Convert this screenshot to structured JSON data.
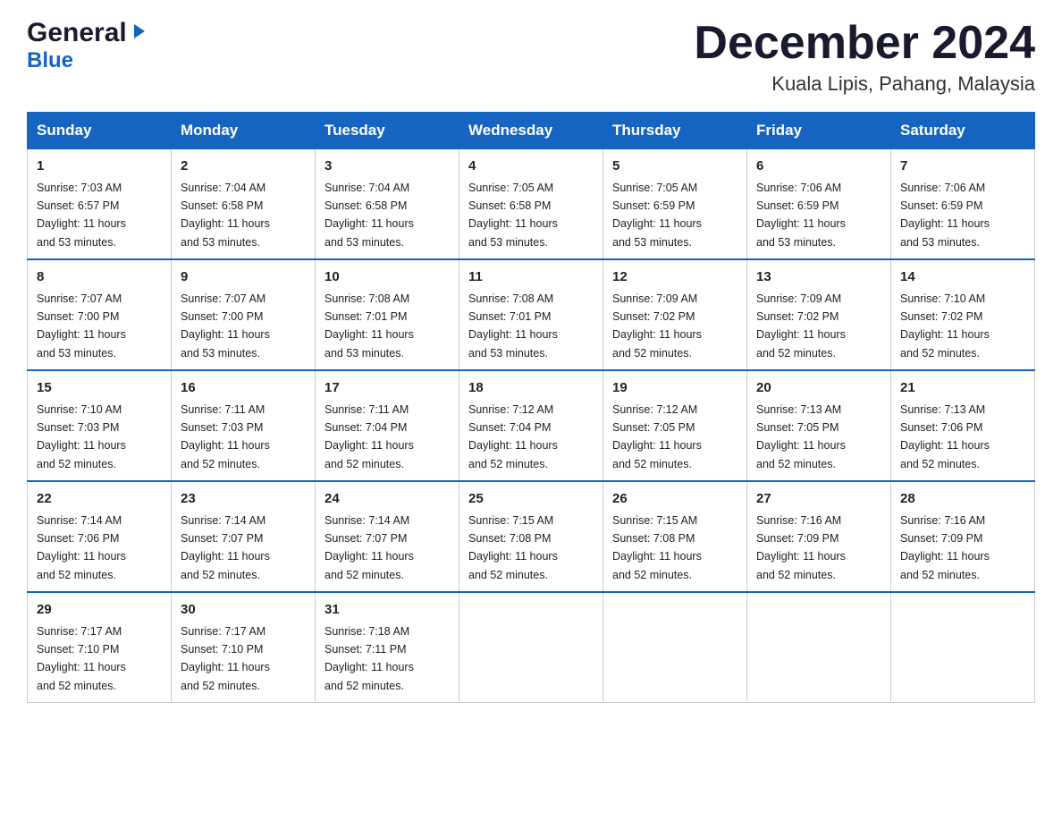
{
  "header": {
    "logo_general": "General",
    "logo_blue": "Blue",
    "month_title": "December 2024",
    "location": "Kuala Lipis, Pahang, Malaysia"
  },
  "days_of_week": [
    "Sunday",
    "Monday",
    "Tuesday",
    "Wednesday",
    "Thursday",
    "Friday",
    "Saturday"
  ],
  "weeks": [
    [
      {
        "day": "1",
        "sunrise": "7:03 AM",
        "sunset": "6:57 PM",
        "daylight": "11 hours and 53 minutes."
      },
      {
        "day": "2",
        "sunrise": "7:04 AM",
        "sunset": "6:58 PM",
        "daylight": "11 hours and 53 minutes."
      },
      {
        "day": "3",
        "sunrise": "7:04 AM",
        "sunset": "6:58 PM",
        "daylight": "11 hours and 53 minutes."
      },
      {
        "day": "4",
        "sunrise": "7:05 AM",
        "sunset": "6:58 PM",
        "daylight": "11 hours and 53 minutes."
      },
      {
        "day": "5",
        "sunrise": "7:05 AM",
        "sunset": "6:59 PM",
        "daylight": "11 hours and 53 minutes."
      },
      {
        "day": "6",
        "sunrise": "7:06 AM",
        "sunset": "6:59 PM",
        "daylight": "11 hours and 53 minutes."
      },
      {
        "day": "7",
        "sunrise": "7:06 AM",
        "sunset": "6:59 PM",
        "daylight": "11 hours and 53 minutes."
      }
    ],
    [
      {
        "day": "8",
        "sunrise": "7:07 AM",
        "sunset": "7:00 PM",
        "daylight": "11 hours and 53 minutes."
      },
      {
        "day": "9",
        "sunrise": "7:07 AM",
        "sunset": "7:00 PM",
        "daylight": "11 hours and 53 minutes."
      },
      {
        "day": "10",
        "sunrise": "7:08 AM",
        "sunset": "7:01 PM",
        "daylight": "11 hours and 53 minutes."
      },
      {
        "day": "11",
        "sunrise": "7:08 AM",
        "sunset": "7:01 PM",
        "daylight": "11 hours and 53 minutes."
      },
      {
        "day": "12",
        "sunrise": "7:09 AM",
        "sunset": "7:02 PM",
        "daylight": "11 hours and 52 minutes."
      },
      {
        "day": "13",
        "sunrise": "7:09 AM",
        "sunset": "7:02 PM",
        "daylight": "11 hours and 52 minutes."
      },
      {
        "day": "14",
        "sunrise": "7:10 AM",
        "sunset": "7:02 PM",
        "daylight": "11 hours and 52 minutes."
      }
    ],
    [
      {
        "day": "15",
        "sunrise": "7:10 AM",
        "sunset": "7:03 PM",
        "daylight": "11 hours and 52 minutes."
      },
      {
        "day": "16",
        "sunrise": "7:11 AM",
        "sunset": "7:03 PM",
        "daylight": "11 hours and 52 minutes."
      },
      {
        "day": "17",
        "sunrise": "7:11 AM",
        "sunset": "7:04 PM",
        "daylight": "11 hours and 52 minutes."
      },
      {
        "day": "18",
        "sunrise": "7:12 AM",
        "sunset": "7:04 PM",
        "daylight": "11 hours and 52 minutes."
      },
      {
        "day": "19",
        "sunrise": "7:12 AM",
        "sunset": "7:05 PM",
        "daylight": "11 hours and 52 minutes."
      },
      {
        "day": "20",
        "sunrise": "7:13 AM",
        "sunset": "7:05 PM",
        "daylight": "11 hours and 52 minutes."
      },
      {
        "day": "21",
        "sunrise": "7:13 AM",
        "sunset": "7:06 PM",
        "daylight": "11 hours and 52 minutes."
      }
    ],
    [
      {
        "day": "22",
        "sunrise": "7:14 AM",
        "sunset": "7:06 PM",
        "daylight": "11 hours and 52 minutes."
      },
      {
        "day": "23",
        "sunrise": "7:14 AM",
        "sunset": "7:07 PM",
        "daylight": "11 hours and 52 minutes."
      },
      {
        "day": "24",
        "sunrise": "7:14 AM",
        "sunset": "7:07 PM",
        "daylight": "11 hours and 52 minutes."
      },
      {
        "day": "25",
        "sunrise": "7:15 AM",
        "sunset": "7:08 PM",
        "daylight": "11 hours and 52 minutes."
      },
      {
        "day": "26",
        "sunrise": "7:15 AM",
        "sunset": "7:08 PM",
        "daylight": "11 hours and 52 minutes."
      },
      {
        "day": "27",
        "sunrise": "7:16 AM",
        "sunset": "7:09 PM",
        "daylight": "11 hours and 52 minutes."
      },
      {
        "day": "28",
        "sunrise": "7:16 AM",
        "sunset": "7:09 PM",
        "daylight": "11 hours and 52 minutes."
      }
    ],
    [
      {
        "day": "29",
        "sunrise": "7:17 AM",
        "sunset": "7:10 PM",
        "daylight": "11 hours and 52 minutes."
      },
      {
        "day": "30",
        "sunrise": "7:17 AM",
        "sunset": "7:10 PM",
        "daylight": "11 hours and 52 minutes."
      },
      {
        "day": "31",
        "sunrise": "7:18 AM",
        "sunset": "7:11 PM",
        "daylight": "11 hours and 52 minutes."
      },
      null,
      null,
      null,
      null
    ]
  ],
  "labels": {
    "sunrise": "Sunrise:",
    "sunset": "Sunset:",
    "daylight": "Daylight:"
  }
}
